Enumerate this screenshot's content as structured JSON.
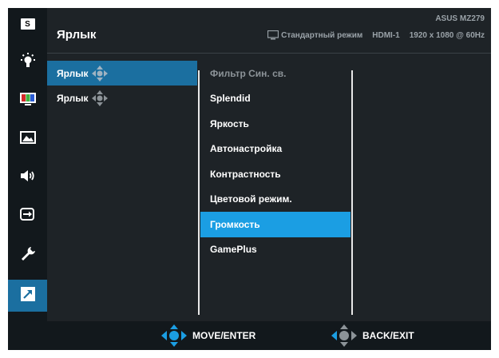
{
  "header": {
    "title": "Ярлык",
    "model": "ASUS MZ279",
    "mode": "Стандартный режим",
    "input": "HDMI-1",
    "resolution": "1920 x 1080 @ 60Hz",
    "mode_icon": "monitor-icon"
  },
  "sidebar": {
    "items": [
      {
        "icon": "splendid-s-icon",
        "label": "S"
      },
      {
        "icon": "blue-light-filter-icon"
      },
      {
        "icon": "color-icon"
      },
      {
        "icon": "image-icon"
      },
      {
        "icon": "sound-icon"
      },
      {
        "icon": "input-select-icon"
      },
      {
        "icon": "system-setup-wrench-icon"
      },
      {
        "icon": "shortcut-arrow-icon",
        "active": true
      }
    ]
  },
  "submenu": {
    "items": [
      {
        "label": "Ярлык",
        "active": true
      },
      {
        "label": "Ярлык",
        "active": false
      }
    ]
  },
  "options": {
    "items": [
      {
        "label": "Фильтр Син. св.",
        "state": "disabled"
      },
      {
        "label": "Splendid",
        "state": "normal"
      },
      {
        "label": "Яркость",
        "state": "normal"
      },
      {
        "label": "Автонастройка",
        "state": "normal"
      },
      {
        "label": "Контрастность",
        "state": "normal"
      },
      {
        "label": "Цветовой режим.",
        "state": "normal"
      },
      {
        "label": "Громкость",
        "state": "selected"
      },
      {
        "label": "GamePlus",
        "state": "normal"
      }
    ]
  },
  "footer": {
    "move_enter": "MOVE/ENTER",
    "back_exit": "BACK/EXIT"
  },
  "colors": {
    "accent": "#1b9ee3",
    "active_dark": "#1b6fa0",
    "panel": "#1e2327",
    "sidebar": "#12181c"
  }
}
